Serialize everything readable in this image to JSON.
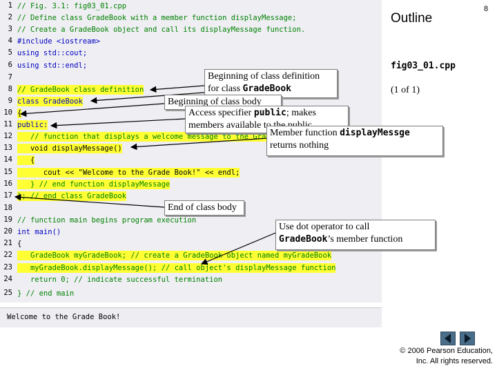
{
  "header": {
    "outline_title": "Outline",
    "page_number": "8",
    "figure_name": "fig03_01.cpp",
    "page_of": "(1 of 1)"
  },
  "code": {
    "lines": [
      {
        "n": "1",
        "text": "// Fig. 3.1: fig03_01.cpp"
      },
      {
        "n": "2",
        "text": "// Define class GradeBook with a member function displayMessage;"
      },
      {
        "n": "3",
        "text": "// Create a GradeBook object and call its displayMessage function."
      },
      {
        "n": "4",
        "text": "#include <iostream>"
      },
      {
        "n": "5",
        "text": "using std::cout;"
      },
      {
        "n": "6",
        "text": "using std::endl;"
      },
      {
        "n": "7",
        "text": ""
      },
      {
        "n": "8",
        "text": "// GradeBook class definition"
      },
      {
        "n": "9",
        "text": "class GradeBook"
      },
      {
        "n": "10",
        "text": "{"
      },
      {
        "n": "11",
        "text": "public:"
      },
      {
        "n": "12",
        "text": "   // function that displays a welcome message to the GradeBook user"
      },
      {
        "n": "13",
        "text": "   void displayMessage()"
      },
      {
        "n": "14",
        "text": "   {"
      },
      {
        "n": "15",
        "text": "      cout << \"Welcome to the Grade Book!\" << endl;"
      },
      {
        "n": "16",
        "text": "   } // end function displayMessage"
      },
      {
        "n": "17",
        "text": "}; // end class GradeBook"
      },
      {
        "n": "18",
        "text": ""
      },
      {
        "n": "19",
        "text": "// function main begins program execution"
      },
      {
        "n": "20",
        "text": "int main()"
      },
      {
        "n": "21",
        "text": "{"
      },
      {
        "n": "22",
        "text": "   GradeBook myGradeBook; // create a GradeBook object named myGradeBook"
      },
      {
        "n": "23",
        "text": "   myGradeBook.displayMessage(); // call object's displayMessage function"
      },
      {
        "n": "24",
        "text": "   return 0; // indicate successful termination"
      },
      {
        "n": "25",
        "text": "} // end main"
      }
    ],
    "output": "Welcome to the Grade Book!"
  },
  "callouts": {
    "class_def_line1": "Beginning of class definition",
    "class_def_line2_pre": "for class ",
    "class_def_code": "GradeBook",
    "class_body": "Beginning of class body",
    "access_pre": "Access specifier ",
    "access_code": "public",
    "access_post": "; makes",
    "access_line2": "members available to the public",
    "member_pre": "Member function ",
    "member_code": "displayMessge",
    "member_line2": "returns nothing",
    "end_body": "End of class body",
    "dot_line1": "Use dot operator to call",
    "dot_code": "GradeBook",
    "dot_post": "’s member function"
  },
  "footer": {
    "copyright_line1": "© 2006 Pearson Education,",
    "copyright_line2": "Inc.  All rights reserved."
  },
  "colors": {
    "highlight": "#ffff33",
    "code_panel": "#eeeef3",
    "nav_button": "#4a6e8a"
  }
}
